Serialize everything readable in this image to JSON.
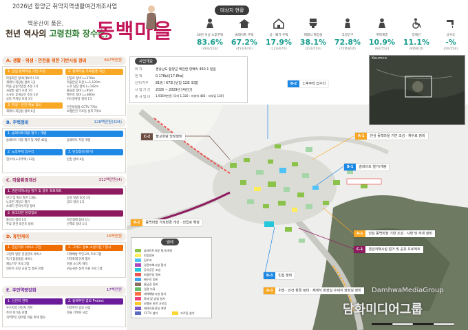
{
  "header": {
    "top_strap": "2026년 함양군 취약지역생활여건개조사업",
    "slogan_line1": "백운산이 품은,",
    "slogan_line2a": "천년 역사의 ",
    "slogan_line2b": "고령친화 장수촌,",
    "village_title": "동백마을"
  },
  "status": {
    "header": "대상지 현황",
    "items": [
      {
        "icon": "elderly-icon",
        "label": "30년 이상 노후주택",
        "value": "83.6%",
        "sub": "(46호/55호)"
      },
      {
        "icon": "slate-roof-icon",
        "label": "슬레이트 주택",
        "value": "67.2%",
        "sub": "(45호/67호)"
      },
      {
        "icon": "house-icon",
        "label": "공 · 폐가 주택",
        "value": "17.9%",
        "sub": "(12호/67호)"
      },
      {
        "icon": "toilet-icon",
        "label": "재래식 화장실",
        "value": "38.1%",
        "sub": "(21호/55호)"
      },
      {
        "icon": "senior-icon",
        "label": "고령인구",
        "value": "72.8%",
        "sub": "(75명/81명)"
      },
      {
        "icon": "solo-senior-icon",
        "label": "취약계층",
        "value": "10.9%",
        "sub": "(6호/55호)"
      },
      {
        "icon": "wheelchair-icon",
        "label": "장애인",
        "value": "11.1%",
        "sub": "(9명/81명)"
      },
      {
        "icon": "water-tap-icon",
        "label": "상수도",
        "value": "-%",
        "sub": "(0호/55호)"
      }
    ]
  },
  "plan": {
    "a": {
      "title": "A. 생활 · 위생 · 안전을 위한 기반시설 정비",
      "budget": "847백만원",
      "sub1": "1. 안심 동백마을 기반 조성",
      "sub2": "2. 동백마을 가로환경 개선",
      "items_left": [
        "마을회관 정비(개보수) 1식",
        "재래식 화장실 정비 3곳",
        "마을 공동작업장 조성 1식",
        "사랑방 쉼터 조성 1식",
        "소규모 휴게공간 조성 2곳",
        "공동 주차장 조성 1식"
      ],
      "items_right": [
        "진입로 정비 L=270m",
        "마을안길 포장 L=1,120m",
        "노후 담장 정비 L=142m",
        "돌담길 정비 L=95m",
        "배수로 정비 L=380m",
        "버스정류장 정비 1식"
      ],
      "sub3": "3. 위생 · 안전 확보 정비",
      "items3_left": [
        "재래식 화장실 정비 6곳",
        "슬레이트 지붕 철거 8동",
        "화재예방시설 설치 1식"
      ],
      "items3_right": [
        "안전방범용 CCTV 7개소",
        "보행안전 가로등 설치 7개소"
      ]
    },
    "b": {
      "title": "B. 주택정비",
      "budget": "128백만원(324)",
      "sub1": "1. 슬레이트지붕 철거 / 개량",
      "items1_left": [
        "슬레이트 지붕 철거 및 개량 45동"
      ],
      "items1_right": [
        "슬레이트 지붕 개량"
      ],
      "sub2": "2. 노후주택 집수리",
      "sub3": "3. 빈집정비(철거)",
      "items2": [
        "집수리(노후주택) 12동"
      ],
      "items3": [
        "빈집 정비 4동"
      ]
    },
    "c": {
      "title": "C. 마을환경개선",
      "budget": "312백만원(4)",
      "sub1": "1. 경관저해시설 철거 및 공유 프로젝트",
      "items1_left": [
        "빈고 및 축사 철거 1개소",
        "노후된 저장고 철거",
        "쓰레기 분리수거장 정비"
      ],
      "items1_right": [
        "공유 텃밭 조성 1식",
        "공터 정비 1식"
      ],
      "sub2": "2. 불고리전 당장정비",
      "items2_left": [
        "돌다리 정비 1식",
        "주요 경관 포인트 정비"
      ],
      "items2_right": [
        "자연생태 정비 1식",
        "산책로 정비 1식"
      ]
    },
    "d": {
      "title": "D. 휴먼케어",
      "budget": "16백만원",
      "sub1": "1. 집단치유 서비스 구현",
      "sub2": "2. 그래드 정보 소셜가든 / 행사",
      "items_left": [
        "고령자 방문 건강관리 서비스",
        "독거 집중돌봄 서비스",
        "재능기부 프로그램",
        "전문가 초청 교육 및 행사 진행"
      ],
      "items_right": [
        "치매예방 주민교육 프로그램",
        "지역축제 연계 행사",
        "마을 소식지 제작",
        "귀농귀촌 정착 지원 프로그램"
      ]
    },
    "e": {
      "title": "E. 주민역량강화",
      "budget": "17백만원",
      "sub1": "1. 선진지 견학",
      "sub2": "2. 동백주민 공모 Project",
      "items_left": [
        "우수지역 선진지 견학",
        "주민 워크숍 진행",
        "지역주민 참여형 마을 축제 행사"
      ],
      "items_right": [
        "지역주민 공모 사업",
        "마을 기록화 사업"
      ]
    }
  },
  "outline": {
    "title": "사업개요",
    "rows": [
      {
        "k": "위 치",
        "v": "경상남도 함양군 백전면 양백리 460-1 일원"
      },
      {
        "k": "면 적",
        "v": "0.178㎢ [17.8ha]"
      },
      {
        "k": "인구/가구",
        "v": "81명 / 67호 [빈집 12호 포함]"
      },
      {
        "k": "사 업 기 간",
        "v": "2026 ~ 2029년 [4년간]"
      },
      {
        "k": "총 사 업 비",
        "v": "1,935백만원 [국비 1,320 : 지방비 485 : 자부담 130]"
      }
    ]
  },
  "inset": {
    "label": "Keumco"
  },
  "tags": [
    {
      "code": "B-2",
      "text": "노후주택 집수리",
      "color": "#1e88e5"
    },
    {
      "code": "C-2",
      "text": "불교회랑 당장정비",
      "color": "#6d4c41"
    },
    {
      "code": "A-1",
      "text": "안심 동백마을 기반 조성 · 재수로 정비",
      "color": "#f9a825"
    },
    {
      "code": "B-1",
      "text": "슬레이트 철거/개량",
      "color": "#1e88e5"
    },
    {
      "code": "A-2",
      "text": "동백마을 가로환경 개선 · 전입로 확장",
      "color": "#f9a825"
    },
    {
      "code": "A-1",
      "text": "안심 동백마을 기반 조성 · 사면 및 추대 정비",
      "color": "#f9a825"
    },
    {
      "code": "C-1",
      "text": "경관저해시설 철거 및 공유 프로젝트",
      "color": "#8e1b5f"
    },
    {
      "code": "B-3",
      "text": "빈집 정비",
      "color": "#1e88e5"
    },
    {
      "code": "A-3",
      "text": "위생 · 안전 환경 정비 · 재래식 화장실 수세식 화장실 정비",
      "color": "#f9a825"
    }
  ],
  "legend": {
    "title": "범례",
    "items": [
      {
        "text": "슬레이트지붕 철거/개량",
        "color": "#8bc34a"
      },
      {
        "text": "빈집정비",
        "color": "#ffee58"
      },
      {
        "text": "집수리",
        "color": "#4fc3f7"
      },
      {
        "text": "경관저해시설 철거",
        "color": "#ab47bc"
      },
      {
        "text": "공유공간 조성",
        "color": "#26c6da"
      },
      {
        "text": "마을안길 정비",
        "color": "#ef5350"
      },
      {
        "text": "배수로 정비",
        "color": "#42a5f5"
      },
      {
        "text": "돌담길 정비",
        "color": "#8d6e63"
      },
      {
        "text": "경관 녹화",
        "color": "#66bb6a"
      },
      {
        "text": "재해예방시설 설치",
        "color": "#ff7043"
      },
      {
        "text": "화재 및 방범 설치",
        "color": "#ec407a"
      },
      {
        "text": "보행자 안전 가로등",
        "color": "#ffca28"
      },
      {
        "text": "재래식화장실 개량",
        "color": "#7e57c2"
      },
      {
        "text": "CCTV 설치",
        "color": "#5c6bc0"
      },
      {
        "text": "가로등 설치",
        "color": "#fdd835"
      }
    ]
  },
  "watermark": {
    "en": "DamhwaMediaGroup",
    "ko": "담화미디어그룹"
  },
  "colors": {
    "title": "#c2185b",
    "accent": "#1a9e8f",
    "a": "#f9a825",
    "b": "#1e88e5",
    "c": "#8e1b5f",
    "d": "#ef6c00",
    "e": "#6a1b9a"
  }
}
